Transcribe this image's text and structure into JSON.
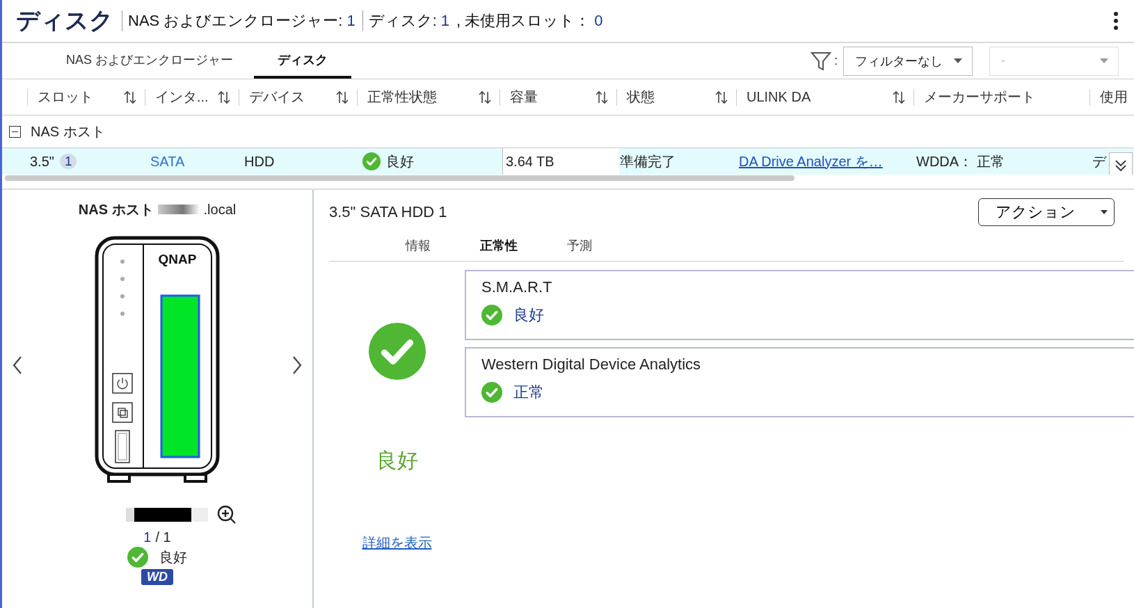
{
  "header": {
    "title": "ディスク",
    "stats": [
      {
        "label": "NAS およびエンクロージャー:",
        "value": "1",
        "divider": true
      },
      {
        "label": "ディスク:",
        "value": "1",
        "divider": true
      },
      {
        "label": ", 未使用スロット：",
        "value": "0",
        "divider": false
      }
    ]
  },
  "tabs": [
    {
      "label": "NAS およびエンクロージャー",
      "selected": false
    },
    {
      "label": "ディスク",
      "selected": true
    }
  ],
  "filter": {
    "colon": ":",
    "value": "フィルターなし",
    "second_value": "-",
    "second_disabled": true
  },
  "table": {
    "columns": [
      {
        "label": "スロット",
        "sortable": true
      },
      {
        "label": "インタ...",
        "sortable": true
      },
      {
        "label": "デバイス",
        "sortable": true
      },
      {
        "label": "正常性状態",
        "sortable": true
      },
      {
        "label": "容量",
        "sortable": true
      },
      {
        "label": "状態",
        "sortable": true
      },
      {
        "label": "ULINK DA",
        "sortable": true
      },
      {
        "label": "メーカーサポート",
        "sortable": false
      },
      {
        "label": "使用"
      }
    ],
    "group": {
      "label": "NAS ホスト",
      "expanded": true
    },
    "rows": [
      {
        "selected": true,
        "slot": "3.5\"",
        "slot_badge": "1",
        "interface": "SATA",
        "device": "HDD",
        "health": "良好",
        "capacity": "3.64 TB",
        "status": "準備完了",
        "ulink": "DA Drive Analyzer を…",
        "maker": "WDDA： 正常",
        "column_9": "デ"
      }
    ]
  },
  "enclosure": {
    "host_label": "NAS ホスト",
    "host_suffix": ".local",
    "brand": "QNAP",
    "pager_current": "1",
    "pager_total": "/ 1",
    "health": "良好",
    "vendor_badge": "WD"
  },
  "detail": {
    "title": "3.5\" SATA HDD 1",
    "action": "アクション",
    "subtabs": [
      {
        "label": "情報",
        "selected": false
      },
      {
        "label": "正常性",
        "selected": true
      },
      {
        "label": "予測",
        "selected": false
      }
    ],
    "overall": "良好",
    "cards": [
      {
        "title": "S.M.A.R.T",
        "status": "良好"
      },
      {
        "title": "Western Digital Device Analytics",
        "status": "正常"
      }
    ],
    "link": "詳細を表示"
  }
}
